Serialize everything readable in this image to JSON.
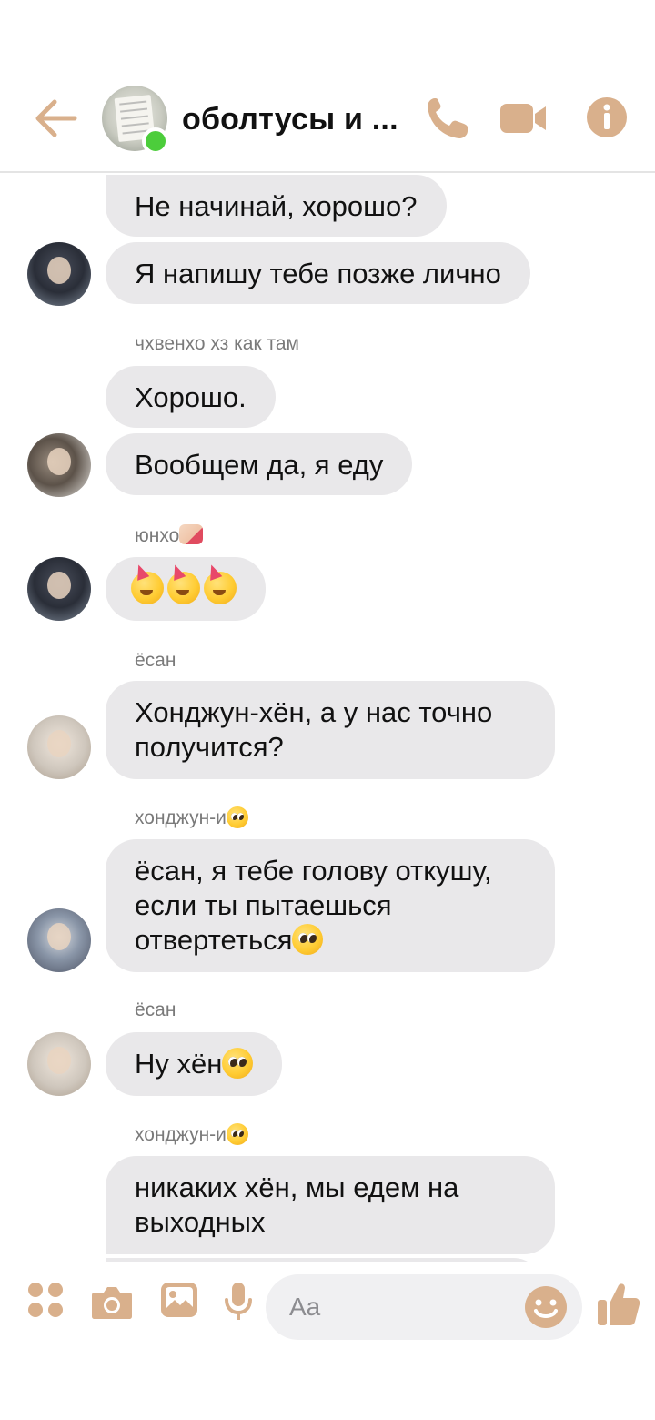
{
  "header": {
    "title": "оболтусы и ...",
    "back_icon": "back-arrow-icon",
    "call_icon": "phone-icon",
    "video_icon": "video-camera-icon",
    "info_icon": "info-icon",
    "accent_color": "#d9b08c",
    "online_color": "#4ccd3b"
  },
  "messages": [
    {
      "text": "Не начинай, хорошо?"
    },
    {
      "text": "Я напишу тебе позже лично"
    },
    {
      "sender": "чхвенхо хз как там"
    },
    {
      "text": "Хорошо."
    },
    {
      "text": "Вообщем да, я еду"
    },
    {
      "sender": "юнхо"
    },
    {
      "emoji": "🥳🥳🥳"
    },
    {
      "sender": "ёсан"
    },
    {
      "line1": "Хонджун-хён, а у нас точно",
      "line2": "получится?"
    },
    {
      "sender": "хонджун-и"
    },
    {
      "line1": "ёсан, я тебе голову откушу,",
      "line2": "если ты пытаешься",
      "line3": "отвертеться"
    },
    {
      "sender": "ёсан"
    },
    {
      "text": "Ну хён"
    },
    {
      "sender": "хонджун-и"
    },
    {
      "line1": "никаких хён, мы едем на",
      "line2": "выходных"
    }
  ],
  "composer": {
    "placeholder": "Aa",
    "menu_icon": "four-dots-menu-icon",
    "camera_icon": "camera-icon",
    "gallery_icon": "gallery-icon",
    "mic_icon": "microphone-icon",
    "emoji_icon": "smile-icon",
    "like_icon": "thumbs-up-icon"
  },
  "bubble_color": "#e9e8ea"
}
